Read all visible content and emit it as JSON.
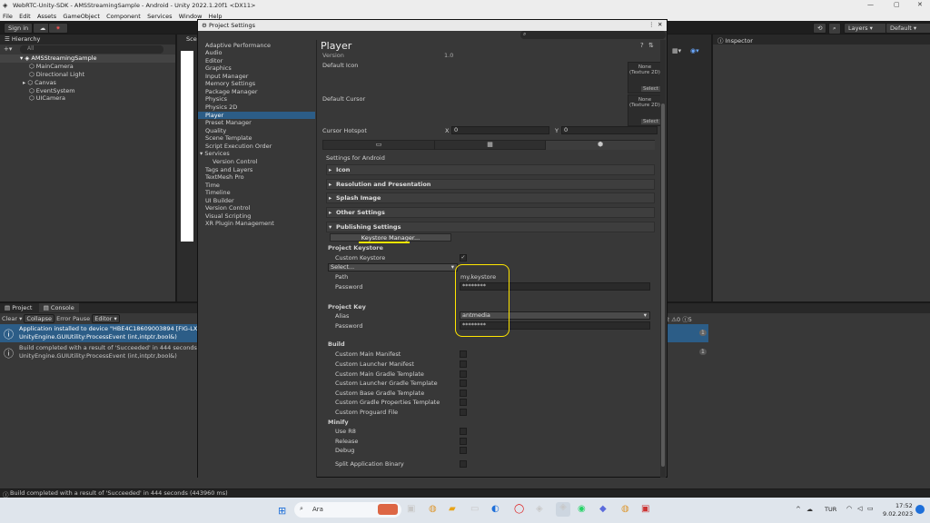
{
  "window": {
    "title": "WebRTC-Unity-SDK - AMSStreamingSample - Android - Unity 2022.1.20f1 <DX11>"
  },
  "menu": [
    "File",
    "Edit",
    "Assets",
    "GameObject",
    "Component",
    "Services",
    "Window",
    "Help"
  ],
  "toolbar": {
    "sign_in": "Sign in",
    "layers": "Layers",
    "layout": "Default"
  },
  "hierarchy": {
    "tab": "Hierarchy",
    "search_placeholder": "All",
    "scene": "AMSStreamingSample",
    "items": [
      "MainCamera",
      "Directional Light",
      "Canvas",
      "EventSystem",
      "UICamera"
    ]
  },
  "scene_tab": "Sce",
  "inspector_tab": "Inspector",
  "console": {
    "tabs": [
      "Project",
      "Console"
    ],
    "buttons": [
      "Clear",
      "Collapse",
      "Error Pause",
      "Editor"
    ],
    "counts": [
      "2",
      "0",
      "5"
    ],
    "rows": [
      {
        "line1": "Application installed to device \"HBE4C18609003894 [FIG-LX1]\".",
        "line2": "UnityEngine.GUIUtility:ProcessEvent (int,intptr,bool&)",
        "count": "1"
      },
      {
        "line1": "Build completed with a result of 'Succeeded' in 444 seconds (443",
        "line2": "UnityEngine.GUIUtility:ProcessEvent (int,intptr,bool&)",
        "count": "1"
      }
    ]
  },
  "status": "Build completed with a result of 'Succeeded' in 444 seconds (443960 ms)",
  "project_settings": {
    "title": "Project Settings",
    "nav": [
      "Adaptive Performance",
      "Audio",
      "Editor",
      "Graphics",
      "Input Manager",
      "Memory Settings",
      "Package Manager",
      "Physics",
      "Physics 2D",
      "Player",
      "Preset Manager",
      "Quality",
      "Scene Template",
      "Script Execution Order",
      "Services",
      "Version Control",
      "Tags and Layers",
      "TextMesh Pro",
      "Time",
      "Timeline",
      "UI Builder",
      "Version Control",
      "Visual Scripting",
      "XR Plugin Management"
    ],
    "selected": "Player",
    "heading": "Player",
    "version_label": "Version",
    "version_value": "1.0",
    "default_icon": "Default Icon",
    "default_cursor": "Default Cursor",
    "texture_none": "None",
    "texture_type": "(Texture 2D)",
    "select_btn": "Select",
    "cursor_hotspot": "Cursor Hotspot",
    "x_label": "X",
    "x_value": "0",
    "y_label": "Y",
    "y_value": "0",
    "settings_for": "Settings for Android",
    "sections": [
      "Icon",
      "Resolution and Presentation",
      "Splash Image",
      "Other Settings"
    ],
    "publishing": "Publishing Settings",
    "keystore_manager": "Keystore Manager...",
    "project_keystore": "Project Keystore",
    "custom_keystore": "Custom Keystore",
    "select_dropdown": "Select...",
    "path_label": "Path",
    "path_value": "my.keystore",
    "password_label": "Password",
    "password_value": "********",
    "project_key": "Project Key",
    "alias_label": "Alias",
    "alias_value": "antmedia",
    "key_password_label": "Password",
    "key_password_value": "********",
    "build_heading": "Build",
    "build_items": [
      "Custom Main Manifest",
      "Custom Launcher Manifest",
      "Custom Main Gradle Template",
      "Custom Launcher Gradle Template",
      "Custom Base Gradle Template",
      "Custom Gradle Properties Template",
      "Custom Proguard File"
    ],
    "minify_heading": "Minify",
    "minify_items": [
      "Use R8",
      "Release",
      "Debug"
    ],
    "split_binary": "Split Application Binary"
  },
  "taskbar": {
    "search": "Ara",
    "lang": "TUR",
    "time": "17:52",
    "date": "9.02.2023"
  },
  "colors": {
    "highlight": "#ffe600",
    "selection": "#2c5d87"
  }
}
